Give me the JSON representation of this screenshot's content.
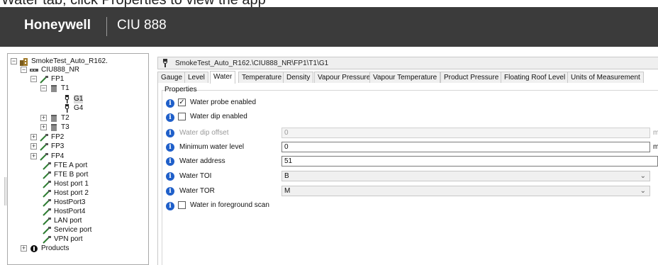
{
  "header": {
    "brand": "Honeywell",
    "product": "CIU 888",
    "cropped_caption": "Water tab, click Properties to view the app"
  },
  "tree": {
    "nodes": [
      {
        "label": "SmokeTest_Auto_R162.",
        "icon": "building-icon"
      },
      {
        "label": "CIU888_NR",
        "icon": "ciu-device-icon"
      },
      {
        "label": "FP1",
        "icon": "network-port-icon"
      },
      {
        "label": "T1",
        "icon": "tank-icon"
      },
      {
        "label": "G1",
        "icon": "gauge-probe-icon"
      },
      {
        "label": "G4",
        "icon": "gauge-probe-icon"
      },
      {
        "label": "T2",
        "icon": "tank-icon"
      },
      {
        "label": "T3",
        "icon": "tank-icon"
      },
      {
        "label": "FP2",
        "icon": "network-port-icon"
      },
      {
        "label": "FP3",
        "icon": "network-port-icon"
      },
      {
        "label": "FP4",
        "icon": "network-port-icon"
      },
      {
        "label": "FTE A port",
        "icon": "network-port-icon"
      },
      {
        "label": "FTE B port",
        "icon": "network-port-icon"
      },
      {
        "label": "Host port 1",
        "icon": "network-port-icon"
      },
      {
        "label": "Host port 2",
        "icon": "network-port-icon"
      },
      {
        "label": "HostPort3",
        "icon": "network-port-icon"
      },
      {
        "label": "HostPort4",
        "icon": "network-port-icon"
      },
      {
        "label": "LAN port",
        "icon": "network-port-icon"
      },
      {
        "label": "Service port",
        "icon": "network-port-icon"
      },
      {
        "label": "VPN port",
        "icon": "network-port-icon"
      },
      {
        "label": "Products",
        "icon": "products-icon"
      }
    ]
  },
  "pathbar": {
    "path": "SmokeTest_Auto_R162.\\CIU888_NR\\FP1\\T1\\G1"
  },
  "tabs": [
    {
      "label": "Gauge"
    },
    {
      "label": "Level"
    },
    {
      "label": "Water",
      "active": true
    },
    {
      "label": "Temperature"
    },
    {
      "label": "Density"
    },
    {
      "label": "Vapour Pressure"
    },
    {
      "label": "Vapour Temperature"
    },
    {
      "label": "Product Pressure"
    },
    {
      "label": "Floating Roof Level"
    },
    {
      "label": "Units of Measurement"
    }
  ],
  "properties": {
    "group_title": "Properties",
    "water_probe_enabled": {
      "label": "Water probe enabled",
      "checked": true
    },
    "water_dip_enabled": {
      "label": "Water dip enabled",
      "checked": false
    },
    "water_dip_offset": {
      "label": "Water dip offset",
      "value": "0",
      "unit": "m",
      "disabled": true
    },
    "minimum_water_level": {
      "label": "Minimum water level",
      "value": "0",
      "unit": "m"
    },
    "water_address": {
      "label": "Water address",
      "value": "51"
    },
    "water_toi": {
      "label": "Water TOI",
      "value": "B"
    },
    "water_tor": {
      "label": "Water TOR",
      "value": "M"
    },
    "water_in_foreground_scan": {
      "label": "Water in foreground scan",
      "checked": false
    }
  },
  "colors": {
    "header_bg": "#3b3b3b",
    "info_icon": "#1f5fc9"
  }
}
